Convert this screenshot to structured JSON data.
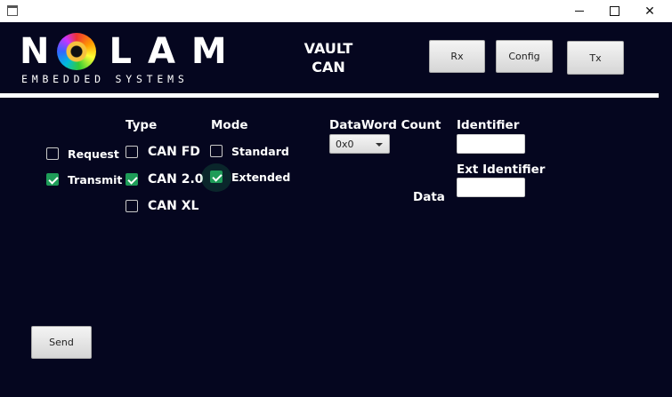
{
  "window": {
    "title": "",
    "controls": {
      "minimize": "minimize-icon",
      "maximize": "maximize-icon",
      "close": "close-icon"
    }
  },
  "logo": {
    "wordmark": "NOLAM",
    "tagline": "EMBEDDED SYSTEMS"
  },
  "header": {
    "line1": "VAULT",
    "line2": "CAN"
  },
  "nav": {
    "rx": "Rx",
    "config": "Config",
    "tx": "Tx"
  },
  "frame": {
    "request_label": "Request",
    "request_checked": false,
    "transmit_label": "Transmit",
    "transmit_checked": true
  },
  "type": {
    "title": "Type",
    "options": [
      {
        "label": "CAN FD",
        "checked": false
      },
      {
        "label": "CAN 2.0",
        "checked": true
      },
      {
        "label": "CAN XL",
        "checked": false
      }
    ]
  },
  "mode": {
    "title": "Mode",
    "options": [
      {
        "label": "Standard",
        "checked": false
      },
      {
        "label": "Extended",
        "checked": true
      }
    ]
  },
  "dataword": {
    "title": "DataWord Count",
    "value": "0x0"
  },
  "identifier": {
    "label": "Identifier",
    "value": ""
  },
  "ext_identifier": {
    "label": "Ext Identifier",
    "value": ""
  },
  "data": {
    "label": "Data"
  },
  "actions": {
    "send": "Send"
  },
  "colors": {
    "background": "#05061f",
    "accent": "#1e9c58"
  }
}
